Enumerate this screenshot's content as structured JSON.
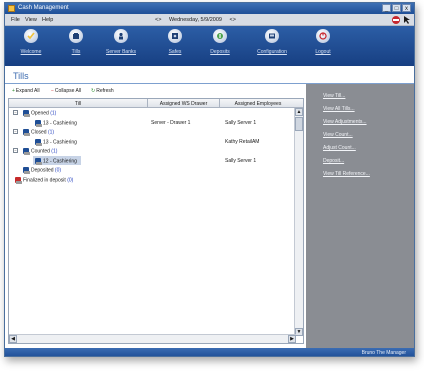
{
  "window": {
    "title": "Cash Management",
    "controls": [
      "_",
      "□",
      "x"
    ]
  },
  "menu": {
    "items": [
      "File",
      "View",
      "Help"
    ],
    "date_prev": "<>",
    "date_text": "Wednesday, 5/9/2009",
    "date_next": "<>"
  },
  "toolbar": {
    "buttons": [
      {
        "label": "Welcome",
        "icon": "welcome-icon"
      },
      {
        "label": "Tills",
        "icon": "tills-icon"
      },
      {
        "label": "Server Banks",
        "icon": "server-banks-icon"
      },
      {
        "label": "Safes",
        "icon": "safes-icon"
      },
      {
        "label": "Deposits",
        "icon": "deposits-icon"
      },
      {
        "label": "Configuration",
        "icon": "configuration-icon"
      },
      {
        "label": "Logout",
        "icon": "logout-icon"
      }
    ]
  },
  "page": {
    "title": "Tills"
  },
  "actions": {
    "expand_all": "Expand All",
    "collapse_all": "Collapse All",
    "refresh": "Refresh"
  },
  "grid": {
    "columns": [
      "Till",
      "Assigned WS Drawer",
      "Assigned Employees"
    ],
    "rows": [
      {
        "kind": "group",
        "label": "Opened",
        "count": "(1)",
        "icon": "till-icon"
      },
      {
        "kind": "item",
        "label": "13 - Cashiering",
        "drawer": "Server - Drawer 1",
        "employee": "Sally Server 1"
      },
      {
        "kind": "group",
        "label": "Closed",
        "count": "(1)",
        "icon": "till-icon"
      },
      {
        "kind": "item",
        "label": "13 - Cashiering",
        "drawer": "",
        "employee": "Kathy RetailAM"
      },
      {
        "kind": "group",
        "label": "Counted",
        "count": "(1)",
        "icon": "till-icon"
      },
      {
        "kind": "item",
        "label": "12 - Cashiering",
        "drawer": "",
        "employee": "Sally Server 1",
        "selected": true
      },
      {
        "kind": "group",
        "label": "Deposited",
        "count": "(0)",
        "icon": "till-icon"
      },
      {
        "kind": "group",
        "label": "Finalized in deposit",
        "count": "(0)",
        "icon": "finalized-icon"
      }
    ]
  },
  "side_panel": {
    "links": [
      "View Till...",
      "View All Tills...",
      "View Adjustments...",
      "View Count...",
      "Adjust Count...",
      "Deposit...",
      "View Till Reference..."
    ]
  },
  "status": {
    "user": "Bruno The Manager"
  },
  "colors": {
    "toolbar": "#1f4f97",
    "side_panel": "#8a8d93",
    "accent": "#3c6bb0"
  }
}
